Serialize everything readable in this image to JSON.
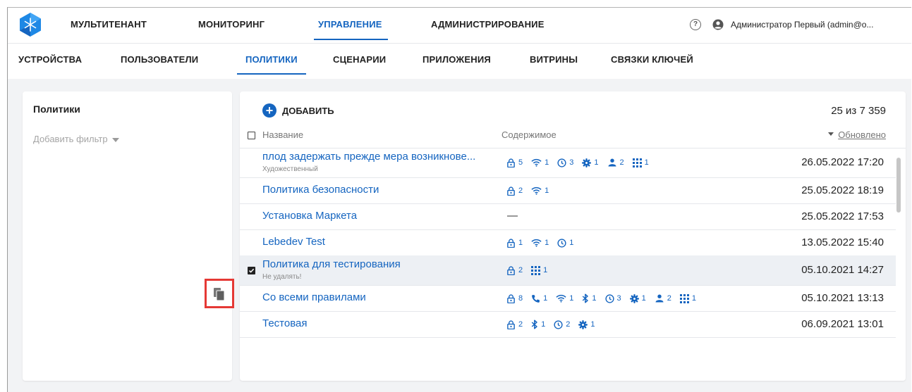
{
  "topnav": [
    "МУЛЬТИТЕНАНТ",
    "МОНИТОРИНГ",
    "УПРАВЛЕНИЕ",
    "АДМИНИСТРИРОВАНИЕ"
  ],
  "topnav_active": "УПРАВЛЕНИЕ",
  "help_glyph": "?",
  "user": "Администратор Первый (admin@o...",
  "subnav": [
    "УСТРОЙСТВА",
    "ПОЛЬЗОВАТЕЛИ",
    "ПОЛИТИКИ",
    "СЦЕНАРИИ",
    "ПРИЛОЖЕНИЯ",
    "ВИТРИНЫ",
    "СВЯЗКИ КЛЮЧЕЙ"
  ],
  "subnav_active": "ПОЛИТИКИ",
  "left": {
    "title": "Политики",
    "filter": "Добавить фильтр"
  },
  "main": {
    "add_label": "ДОБАВИТЬ",
    "count": "25 из 7 359",
    "headers": {
      "name": "Название",
      "content": "Содержимое",
      "updated": "Обновлено"
    }
  },
  "colors": {
    "accent": "#1565c0",
    "highlight": "#e53935",
    "selected_row": "#edf0f4"
  },
  "rows": [
    {
      "name": "плод задержать прежде мера возникнове...",
      "subtitle": "Художественный",
      "date": "26.05.2022 17:20",
      "checked": false,
      "icons": [
        [
          "lock-icon",
          "5"
        ],
        [
          "wifi-icon",
          "1"
        ],
        [
          "clock-icon",
          "3"
        ],
        [
          "gear-icon",
          "1"
        ],
        [
          "user-icon",
          "2"
        ],
        [
          "apps-grid-icon",
          "1"
        ]
      ]
    },
    {
      "name": "Политика безопасности",
      "subtitle": "",
      "date": "25.05.2022 18:19",
      "checked": false,
      "icons": [
        [
          "lock-icon",
          "2"
        ],
        [
          "wifi-icon",
          "1"
        ]
      ]
    },
    {
      "name": "Установка Маркета",
      "subtitle": "",
      "date": "25.05.2022 17:53",
      "checked": false,
      "dash": "—",
      "icons": []
    },
    {
      "name": "Lebedev Test",
      "subtitle": "",
      "date": "13.05.2022 15:40",
      "checked": false,
      "icons": [
        [
          "lock-icon",
          "1"
        ],
        [
          "wifi-icon",
          "1"
        ],
        [
          "clock-icon",
          "1"
        ]
      ]
    },
    {
      "name": "Политика для тестирования",
      "subtitle": "Не удалять!",
      "date": "05.10.2021 14:27",
      "checked": true,
      "icons": [
        [
          "lock-icon",
          "2"
        ],
        [
          "apps-grid-icon",
          "1"
        ]
      ]
    },
    {
      "name": "Со всеми правилами",
      "subtitle": "",
      "date": "05.10.2021 13:13",
      "checked": false,
      "icons": [
        [
          "lock-icon",
          "8"
        ],
        [
          "phone-icon",
          "1"
        ],
        [
          "wifi-icon",
          "1"
        ],
        [
          "bluetooth-icon",
          "1"
        ],
        [
          "clock-icon",
          "3"
        ],
        [
          "gear-icon",
          "1"
        ],
        [
          "user-icon",
          "2"
        ],
        [
          "apps-grid-icon",
          "1"
        ]
      ]
    },
    {
      "name": "Тестовая",
      "subtitle": "",
      "date": "06.09.2021 13:01",
      "checked": false,
      "icons": [
        [
          "lock-icon",
          "2"
        ],
        [
          "bluetooth-icon",
          "1"
        ],
        [
          "clock-icon",
          "2"
        ],
        [
          "gear-icon",
          "1"
        ]
      ]
    }
  ]
}
